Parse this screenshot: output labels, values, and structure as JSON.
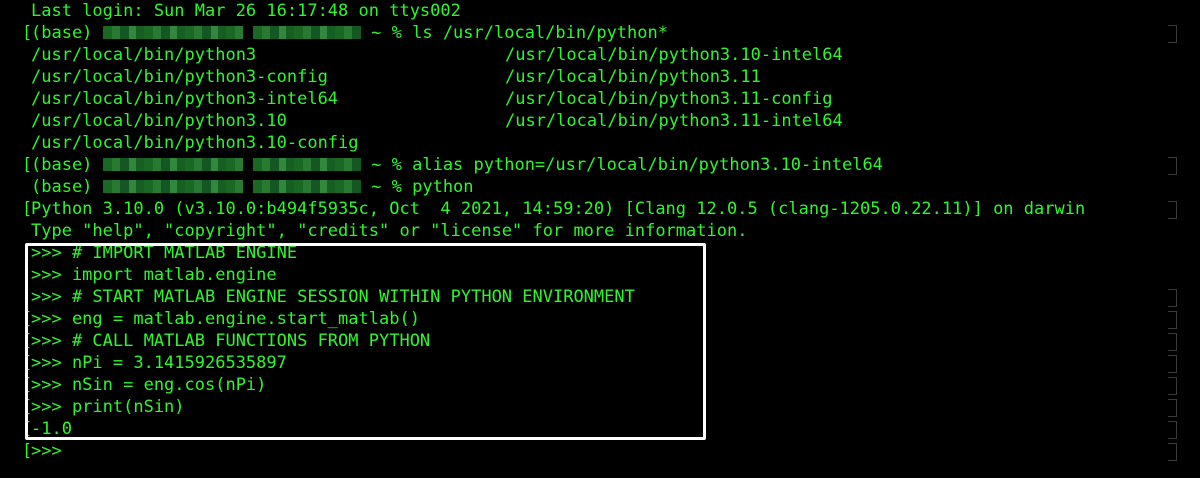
{
  "terminal": {
    "last_login": "Last login: Sun Mar 26 16:17:48 on ttys002",
    "prompt_env": "(base)",
    "prompt_symbol": " ~ % ",
    "cmd_ls": "ls /usr/local/bin/python*",
    "ls_col1": [
      "/usr/local/bin/python3",
      "/usr/local/bin/python3-config",
      "/usr/local/bin/python3-intel64",
      "/usr/local/bin/python3.10",
      "/usr/local/bin/python3.10-config"
    ],
    "ls_col2": [
      "/usr/local/bin/python3.10-intel64",
      "/usr/local/bin/python3.11",
      "/usr/local/bin/python3.11-config",
      "/usr/local/bin/python3.11-intel64"
    ],
    "cmd_alias": "alias python=/usr/local/bin/python3.10-intel64",
    "cmd_python": "python",
    "python_banner": "Python 3.10.0 (v3.10.0:b494f5935c, Oct  4 2021, 14:59:20) [Clang 12.0.5 (clang-1205.0.22.11)] on darwin",
    "python_help": "Type \"help\", \"copyright\", \"credits\" or \"license\" for more information.",
    "repl_lines": [
      ">>> # IMPORT MATLAB ENGINE",
      ">>> import matlab.engine",
      ">>> # START MATLAB ENGINE SESSION WITHIN PYTHON ENVIRONMENT",
      ">>> eng = matlab.engine.start_matlab()",
      ">>> # CALL MATLAB FUNCTIONS FROM PYTHON",
      ">>> nPi = 3.1415926535897",
      ">>> nSin = eng.cos(nPi)",
      ">>> print(nSin)"
    ],
    "output": "-1.0",
    "final_prompt": ">>>"
  },
  "colors": {
    "text": "#2ff52f",
    "background": "#000000",
    "highlight_border": "#ffffff"
  }
}
